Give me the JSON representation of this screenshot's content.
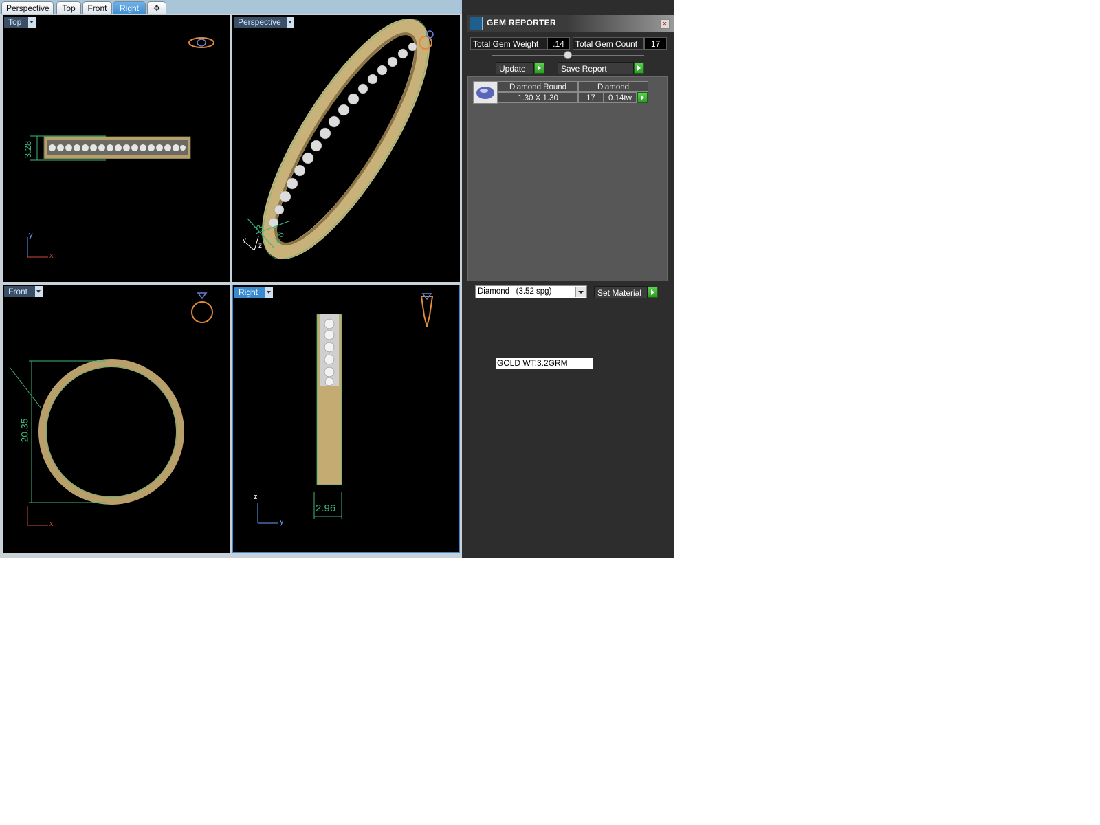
{
  "tabs": [
    {
      "label": "Perspective"
    },
    {
      "label": "Top"
    },
    {
      "label": "Front"
    },
    {
      "label": "Right"
    },
    {
      "label": "✥"
    }
  ],
  "viewports": {
    "top": {
      "label": "Top",
      "dim_label": "3.28",
      "axis_vertical": "y",
      "axis_horizontal": "x"
    },
    "perspective": {
      "label": "Perspective",
      "dim_label_a": "3",
      "dim_label_b": "2.8",
      "axis_y": "y",
      "axis_z": "z"
    },
    "front": {
      "label": "Front",
      "dim_label": "20.35",
      "axis_horizontal": "x"
    },
    "right": {
      "label": "Right",
      "dim_label": "2.96",
      "axis_vertical": "z",
      "axis_horizontal": "y"
    }
  },
  "gem_reporter": {
    "title": "GEM REPORTER",
    "close_glyph": "×",
    "total_gem_weight_label": "Total Gem Weight",
    "total_gem_weight_value": ".14",
    "total_gem_count_label": "Total Gem Count",
    "total_gem_count_value": "17",
    "update_label": "Update",
    "save_report_label": "Save Report",
    "gem_row": {
      "shape": "Diamond Round",
      "material": "Diamond",
      "size": "1.30 X 1.30",
      "count": "17",
      "weight": "0.14tw"
    },
    "material_select": {
      "name": "Diamond",
      "spg": "(3.52 spg)"
    },
    "set_material_label": "Set Material"
  },
  "note": "GOLD WT:3.2GRM",
  "colors": {
    "viewport_bg": "#000000",
    "gold": "#c9b27a",
    "dimension": "#3cb878",
    "panel_bg": "#2d2d2d",
    "accent_tab": "#3a8ad0"
  }
}
